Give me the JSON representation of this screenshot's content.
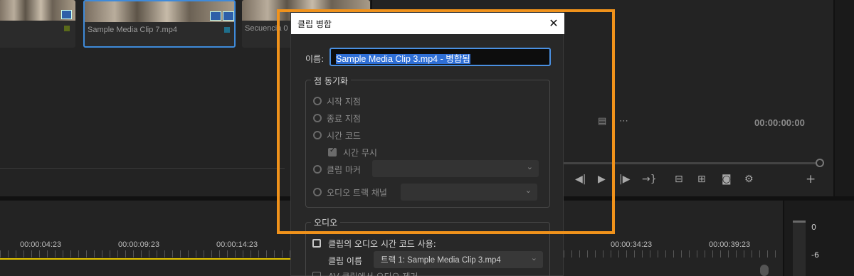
{
  "bin": {
    "clips": [
      {
        "name": ""
      },
      {
        "name": "Sample Media Clip 7.mp4"
      },
      {
        "name": "Secuencia 0"
      }
    ]
  },
  "monitor": {
    "timecode": "00:00:00:00",
    "transport_buttons": [
      "◀|",
      "▶",
      "|▶",
      "→}"
    ],
    "tool_icons": [
      "lift-icon",
      "extract-icon",
      "camera-icon",
      "settings-icon"
    ],
    "add_label": "+"
  },
  "timeline": {
    "timecodes": [
      "00:00:04:23",
      "00:00:09:23",
      "00:00:14:23",
      "00:00:34:23",
      "00:00:39:23"
    ]
  },
  "meter": {
    "labels": [
      "0",
      "-6"
    ]
  },
  "dialog": {
    "title": "클립 병합",
    "close_label": "✕",
    "name_label": "이름:",
    "name_value": "Sample Media Clip 3.mp4 - 병합됨",
    "sync_group_title": "점 동기화",
    "sync_options": {
      "start": "시작 지점",
      "end": "종료 지점",
      "timecode": "시간 코드",
      "ignore_time": "시간 무시",
      "clip_marker": "클립 마커",
      "audio_channel": "오디오 트랙 채널"
    },
    "audio_group_title": "오디오",
    "use_audio_tc": "클립의 오디오 시간 코드 사용:",
    "clip_name_label": "클립 이름",
    "clip_name_value": "트랙 1: Sample Media Clip 3.mp4",
    "remove_audio_partial": "AV 클립에서 오디오 제거"
  },
  "colors": {
    "highlight": "#f0921b",
    "selection": "#2f6fd6",
    "playhead": "#e3c400"
  }
}
